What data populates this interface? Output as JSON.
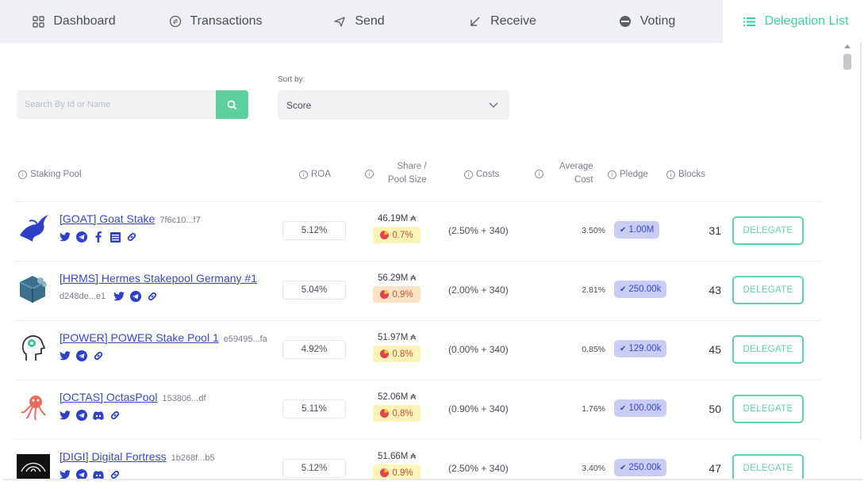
{
  "tabs": [
    {
      "label": "Dashboard",
      "icon": "dashboard-icon",
      "active": false
    },
    {
      "label": "Transactions",
      "icon": "transactions-icon",
      "active": false
    },
    {
      "label": "Send",
      "icon": "send-icon",
      "active": false
    },
    {
      "label": "Receive",
      "icon": "receive-icon",
      "active": false
    },
    {
      "label": "Voting",
      "icon": "voting-icon",
      "active": false
    },
    {
      "label": "Delegation List",
      "icon": "list-icon",
      "active": true
    }
  ],
  "search": {
    "placeholder": "Search By Id or Name",
    "value": ""
  },
  "sort": {
    "label": "Sort by:",
    "value": "Score"
  },
  "columns": {
    "staking_pool": "Staking Pool",
    "roa": "ROA",
    "share_line1": "Share /",
    "share_line2": "Pool Size",
    "costs": "Costs",
    "avg_line1": "Average",
    "avg_line2": "Cost",
    "pledge": "Pledge",
    "blocks": "Blocks"
  },
  "delegate_label": "DELEGATE",
  "colors": {
    "accent": "#5fd3a5",
    "link": "#3a48c9",
    "pledge_bg": "#c9cdf5"
  },
  "pools": [
    {
      "name": "[GOAT] Goat Stake",
      "id": "7f6c10...f7",
      "roa": "5.12%",
      "share": "46.19M",
      "pct": "0.7%",
      "costs": "(2.50% + 340)",
      "avg": "3.50%",
      "pledge": "1.00M",
      "blocks": "31",
      "socials": [
        "twitter-icon",
        "telegram-icon",
        "facebook-icon",
        "document-icon",
        "link-icon"
      ]
    },
    {
      "name": "[HRMS] Hermes Stakepool Germany #1",
      "id": "d248de...e1",
      "roa": "5.04%",
      "share": "56.29M",
      "pct": "0.9%",
      "costs": "(2.00% + 340)",
      "avg": "2.81%",
      "pledge": "250.00k",
      "blocks": "43",
      "socials": [
        "twitter-icon",
        "telegram-icon",
        "link-icon"
      ]
    },
    {
      "name": "[POWER] POWER Stake Pool 1",
      "id": "e59495...fa",
      "roa": "4.92%",
      "share": "51.97M",
      "pct": "0.8%",
      "costs": "(0.00% + 340)",
      "avg": "0.85%",
      "pledge": "129.00k",
      "blocks": "45",
      "socials": [
        "twitter-icon",
        "telegram-icon",
        "link-icon"
      ]
    },
    {
      "name": "[OCTAS] OctasPool",
      "id": "153806...df",
      "roa": "5.11%",
      "share": "52.06M",
      "pct": "0.8%",
      "costs": "(0.90% + 340)",
      "avg": "1.76%",
      "pledge": "100.00k",
      "blocks": "50",
      "socials": [
        "twitter-icon",
        "telegram-icon",
        "discord-icon",
        "link-icon"
      ]
    },
    {
      "name": "[DIGI] Digital Fortress",
      "id": "1b268f...b5",
      "roa": "5.12%",
      "share": "51.66M",
      "pct": "0.9%",
      "costs": "(2.50% + 340)",
      "avg": "3.40%",
      "pledge": "250.00k",
      "blocks": "47",
      "socials": [
        "twitter-icon",
        "telegram-icon",
        "discord-icon",
        "link-icon"
      ]
    }
  ]
}
